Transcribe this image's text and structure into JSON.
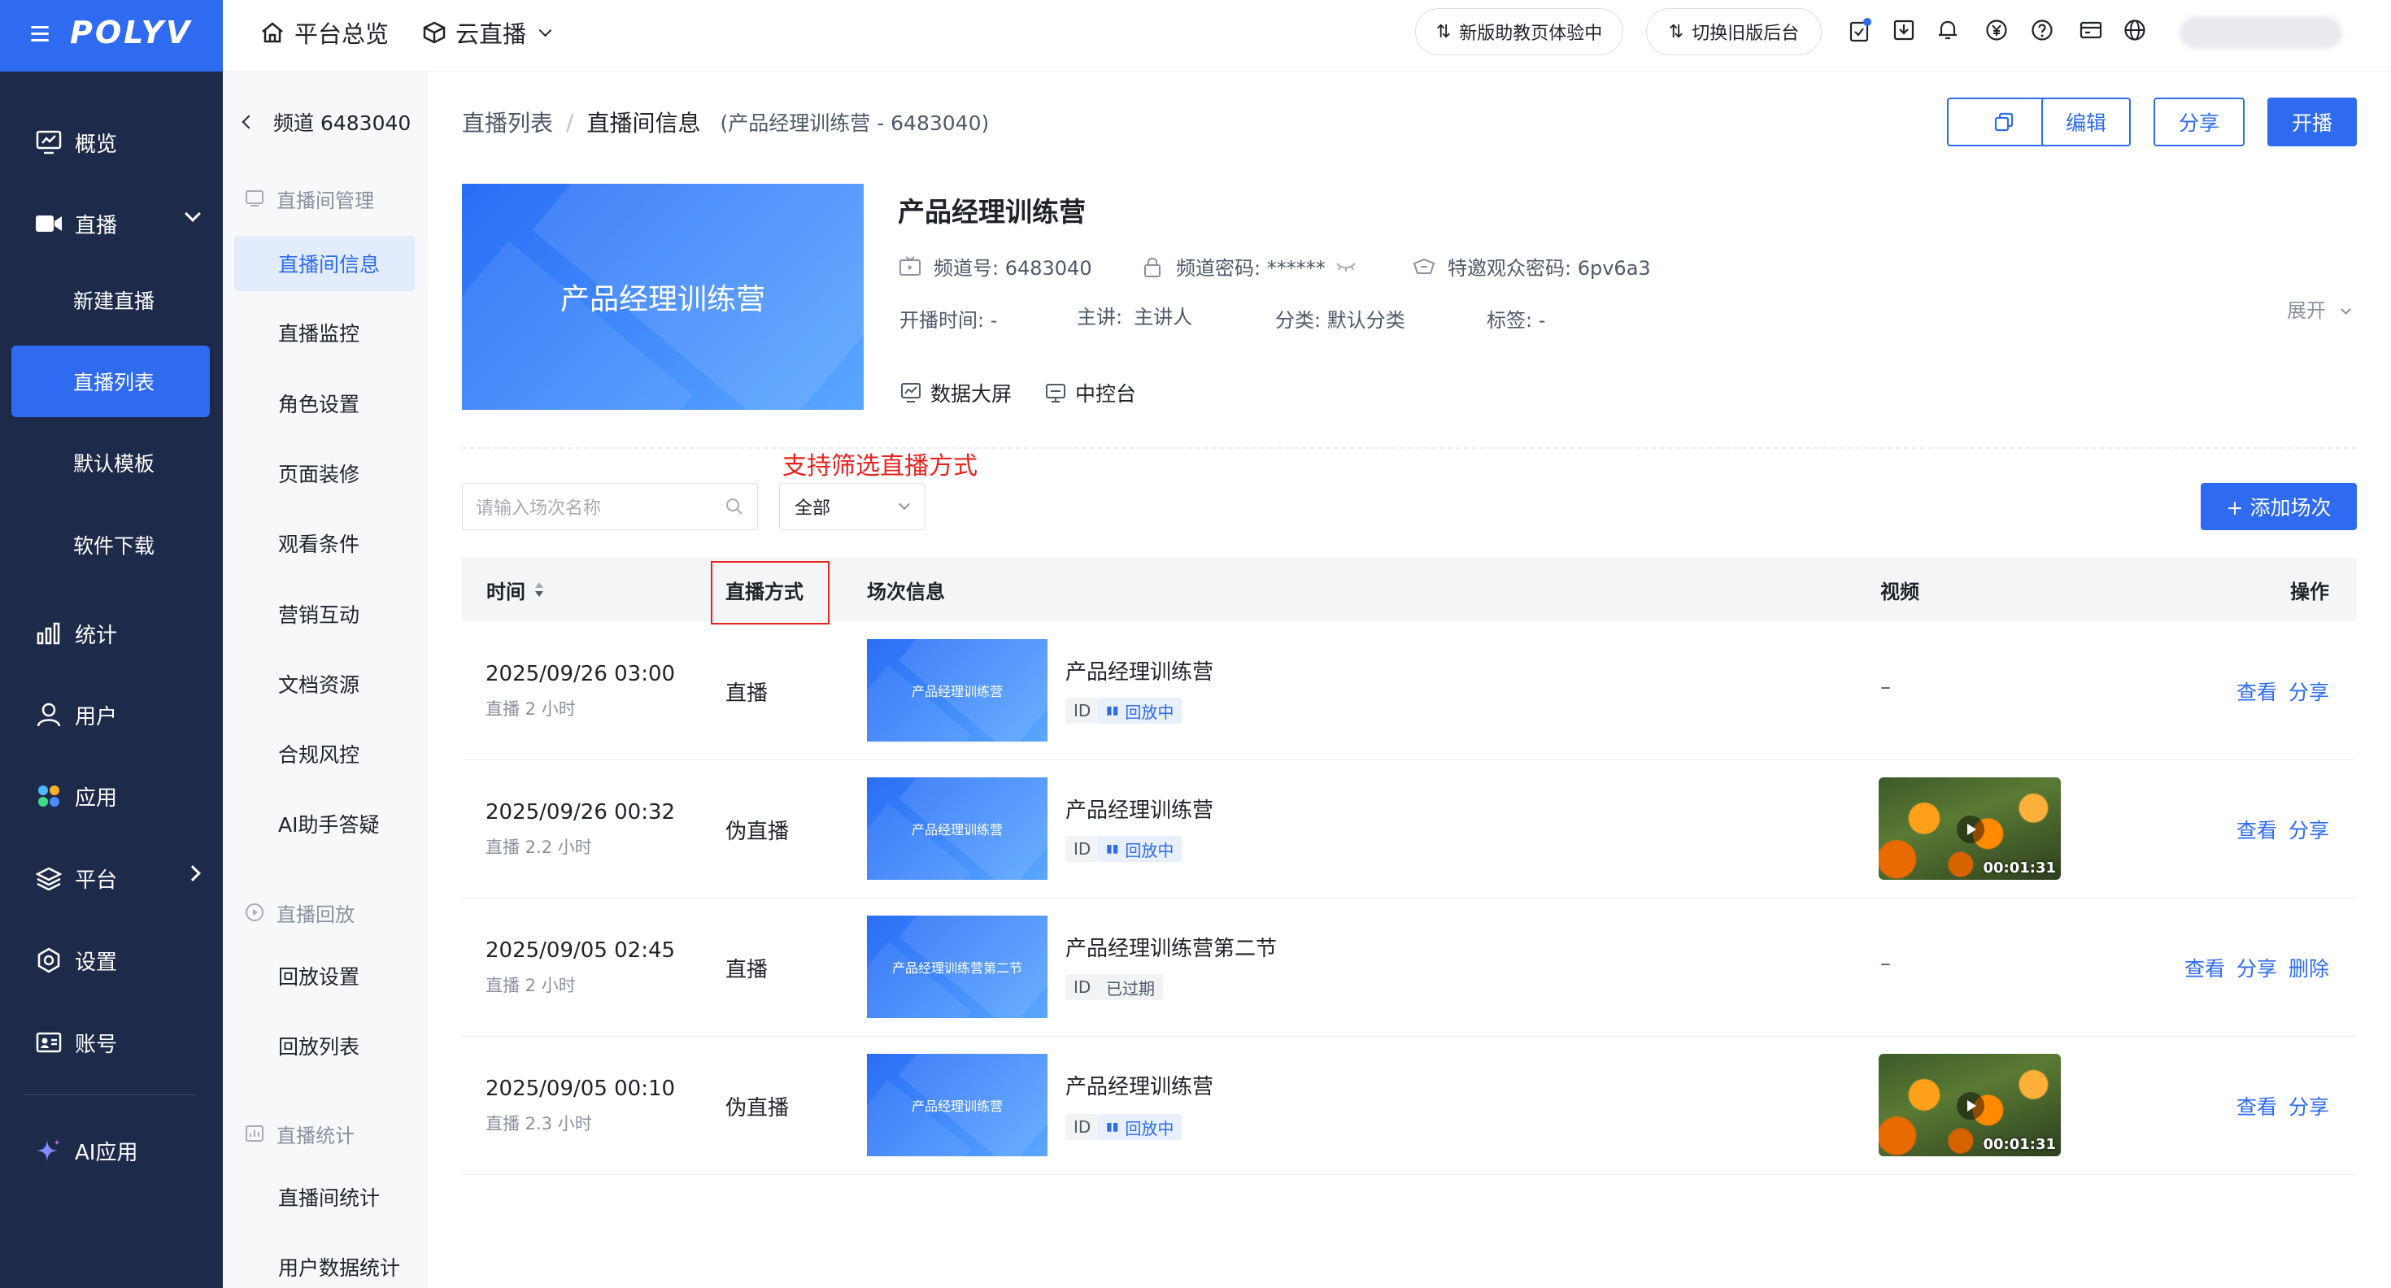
{
  "app": {
    "logo": "POLYV",
    "brand_color": "#2e6bf0",
    "nav_bg": "#1e2a4a",
    "annotation_color": "#e8231f"
  },
  "top": {
    "tabs": [
      {
        "label": "平台总览",
        "icon": "home-icon"
      },
      {
        "label": "云直播",
        "icon": "cube-icon"
      }
    ],
    "new_version_btn": "新版助教页体验中",
    "old_version_btn": "切换旧版后台"
  },
  "nav": {
    "items": [
      {
        "label": "概览",
        "icon": "monitor-icon"
      },
      {
        "label": "直播",
        "icon": "video-camera-icon"
      },
      {
        "label": "统计",
        "icon": "bar-chart-icon"
      },
      {
        "label": "用户",
        "icon": "user-icon"
      },
      {
        "label": "应用",
        "icon": "apps-icon"
      },
      {
        "label": "平台",
        "icon": "layers-icon"
      },
      {
        "label": "设置",
        "icon": "gear-icon"
      },
      {
        "label": "账号",
        "icon": "id-card-icon"
      },
      {
        "label": "AI应用",
        "icon": "sparkle-icon"
      }
    ],
    "live_sub": [
      "新建直播",
      "直播列表",
      "默认模板",
      "软件下载"
    ]
  },
  "subnav": {
    "channel": "频道 6483040",
    "groups": [
      "直播间管理",
      "直播回放",
      "直播统计"
    ],
    "room_items": [
      "直播间信息",
      "直播监控",
      "角色设置",
      "页面装修",
      "观看条件",
      "营销互动",
      "文档资源",
      "合规风控",
      "AI助手答疑"
    ],
    "replay_items": [
      "回放设置",
      "回放列表"
    ],
    "stats_items": [
      "直播间统计",
      "用户数据统计"
    ]
  },
  "breadcrumb": {
    "parent": "直播列表",
    "sep": "/",
    "current": "直播间信息",
    "sub": "(产品经理训练营 - 6483040)"
  },
  "actions": {
    "edit": "编辑",
    "share": "分享",
    "start": "开播"
  },
  "room": {
    "cover_text": "产品经理训练营",
    "title": "产品经理训练营",
    "channel_no": "频道号: 6483040",
    "password": "频道密码: ******",
    "invite_password": "特邀观众密码: 6pv6a3",
    "start_time": "开播时间: -",
    "speaker_label": "主讲:",
    "speaker": "主讲人",
    "category": "分类: 默认分类",
    "tags": "标签: -",
    "expand": "展开",
    "data_screen": "数据大屏",
    "control_panel": "中控台"
  },
  "annotation": "支持筛选直播方式",
  "filters": {
    "search_placeholder": "请输入场次名称",
    "mode_value": "全部",
    "add_button": "+ 添加场次"
  },
  "table": {
    "headers": {
      "time": "时间",
      "mode": "直播方式",
      "session": "场次信息",
      "video": "视频",
      "ops": "操作"
    },
    "rows": [
      {
        "date": "2025/09/26 03:00",
        "duration": "直播 2 小时",
        "mode": "直播",
        "cover_text": "产品经理训练营",
        "title": "产品经理训练营",
        "id_tag": "ID",
        "status": "回放中",
        "video": "–",
        "ops": [
          "查看",
          "分享"
        ]
      },
      {
        "date": "2025/09/26 00:32",
        "duration": "直播 2.2 小时",
        "mode": "伪直播",
        "cover_text": "产品经理训练营",
        "title": "产品经理训练营",
        "id_tag": "ID",
        "status": "回放中",
        "video_duration": "00:01:31",
        "ops": [
          "查看",
          "分享"
        ]
      },
      {
        "date": "2025/09/05 02:45",
        "duration": "直播 2 小时",
        "mode": "直播",
        "cover_text": "产品经理训练营第二节",
        "title": "产品经理训练营第二节",
        "id_tag": "ID",
        "status": "已过期",
        "video": "–",
        "ops": [
          "查看",
          "分享",
          "删除"
        ]
      },
      {
        "date": "2025/09/05 00:10",
        "duration": "直播 2.3 小时",
        "mode": "伪直播",
        "cover_text": "产品经理训练营",
        "title": "产品经理训练营",
        "id_tag": "ID",
        "status": "回放中",
        "video_duration": "00:01:31",
        "ops": [
          "查看",
          "分享"
        ]
      }
    ]
  }
}
